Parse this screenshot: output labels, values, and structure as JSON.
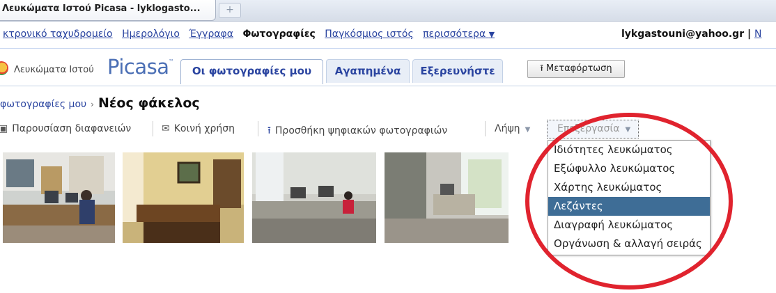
{
  "browser": {
    "tab_title": "Λευκώματα Ιστού Picasa - lyklogasto...",
    "new_tab_symbol": "+"
  },
  "google_bar": {
    "links": [
      "κτρονικό ταχυδρομείο",
      "Ημερολόγιο",
      "Έγγραφα"
    ],
    "current": "Φωτογραφίες",
    "links_after": [
      "Παγκόσμιος ιστός",
      "περισσότερα"
    ],
    "more_caret": "▼",
    "user_email": "lykgastouni@yahoo.gr",
    "divider": "|",
    "cut_link": "N"
  },
  "picasa_header": {
    "logo_text": "Λευκώματα Ιστού",
    "logo_brand": "Picasa",
    "logo_tm": "™",
    "tabs": [
      {
        "label": "Οι φωτογραφίες μου",
        "active": true
      },
      {
        "label": "Αγαπημένα",
        "active": false
      },
      {
        "label": "Εξερευνήστε",
        "active": false
      }
    ],
    "upload_label": "Μεταφόρτωση",
    "upload_icon": "upload-icon"
  },
  "breadcrumb": {
    "parent": "φωτογραφίες μου",
    "separator": "›",
    "current": "Νέος φάκελος"
  },
  "toolbar": {
    "slideshow_label": "Παρουσίαση διαφανειών",
    "share_label": "Κοινή χρήση",
    "add_photos_label": "Προσθήκη ψηφιακών φωτογραφιών",
    "download_label": "Λήψη",
    "edit_label": "Επεξεργασία",
    "caret": "▼"
  },
  "photos": [
    "office-photo-1",
    "office-photo-2",
    "office-photo-3",
    "office-photo-4"
  ],
  "edit_menu": {
    "items": [
      {
        "label": "Ιδιότητες λευκώματος",
        "selected": false
      },
      {
        "label": "Εξώφυλλο λευκώματος",
        "selected": false
      },
      {
        "label": "Χάρτης λευκώματος",
        "selected": false
      },
      {
        "label": "Λεζάντες",
        "selected": true
      },
      {
        "label": "Διαγραφή λευκώματος",
        "selected": false
      },
      {
        "label": "Οργάνωση & αλλαγή σειράς",
        "selected": false
      }
    ]
  },
  "colors": {
    "link": "#2a44a0",
    "menu_selected_bg": "#3e6d96",
    "annotation_red": "#e0232e"
  }
}
